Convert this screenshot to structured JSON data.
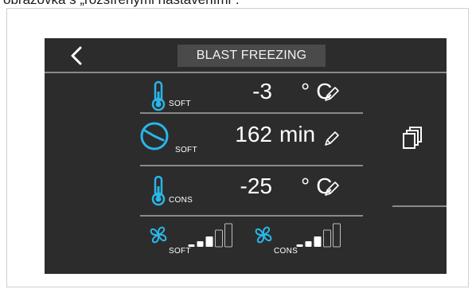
{
  "caption": "obrázovka s „rozšířenými nastaveními“.",
  "header": {
    "title": "BLAST FREEZING",
    "back_icon": "chevron-left-icon"
  },
  "rows": [
    {
      "name": "temperature-soft",
      "icon": "thermometer-icon",
      "sub": "SOFT",
      "value": "-3",
      "unit": "°C",
      "edit_icon": "pencil-icon"
    },
    {
      "name": "time-soft",
      "icon": "clock-icon",
      "sub": "SOFT",
      "value": "162",
      "unit": "min",
      "edit_icon": "pencil-icon"
    },
    {
      "name": "temperature-cons",
      "icon": "thermometer-icon",
      "sub": "CONS",
      "value": "-25",
      "unit": "°C",
      "edit_icon": "pencil-icon"
    }
  ],
  "fans": [
    {
      "name": "fan-soft",
      "icon": "fan-icon",
      "sub": "SOFT",
      "level": 3,
      "max_level": 5
    },
    {
      "name": "fan-cons",
      "icon": "fan-icon",
      "sub": "CONS",
      "level": 3,
      "max_level": 5
    }
  ],
  "side": {
    "copy_icon": "copy-icon"
  },
  "colors": {
    "screen_bg": "#2c2c2c",
    "accent": "#29b6e8",
    "text": "#ffffff",
    "divider": "#8a8a8a",
    "title_bg": "#4a4a4a"
  }
}
